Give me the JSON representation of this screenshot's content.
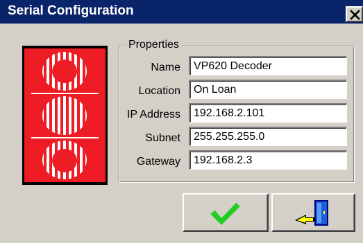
{
  "window": {
    "title": "Serial Configuration",
    "close_label": "close"
  },
  "logo": {
    "icon": "kramer-logo-icon",
    "background_color": "#ee1c24",
    "stripe_color": "#ffffff"
  },
  "properties": {
    "group_label": "Properties",
    "fields": [
      {
        "label": "Name",
        "value": "VP620 Decoder"
      },
      {
        "label": "Location",
        "value": "On Loan"
      },
      {
        "label": "IP Address",
        "value": "192.168.2.101"
      },
      {
        "label": "Subnet",
        "value": "255.255.255.0"
      },
      {
        "label": "Gateway",
        "value": "192.168.2.3"
      }
    ]
  },
  "buttons": {
    "ok": {
      "icon": "checkmark-icon",
      "color": "#22cc22"
    },
    "exit": {
      "icon": "exit-door-icon"
    }
  },
  "colors": {
    "titlebar": "#0a246a",
    "dialog_face": "#d4d0c8"
  }
}
